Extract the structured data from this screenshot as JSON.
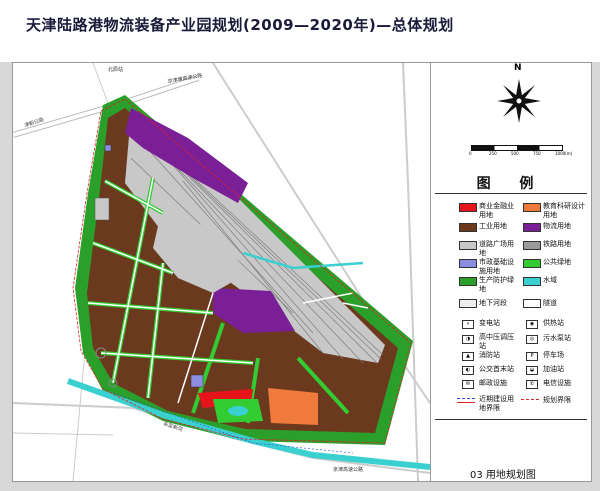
{
  "title": "天津陆路港物流装备产业园规划(2009—2020年)—总体规划",
  "footer": "03 用地规划图",
  "north_label": "N",
  "scale_ticks": [
    "0",
    "250",
    "500",
    "750",
    "1000(m)"
  ],
  "map_labels": {
    "road_top": "京津塘高速公路",
    "road_left": "津蓟公路",
    "road_bottom": "京津高速公路",
    "river": "永定新河",
    "station_top": "北辰站"
  },
  "legend": {
    "heading": "图 例",
    "items": [
      {
        "label": "商业金融业用地",
        "color": "#e8141c"
      },
      {
        "label": "教育科研设计用地",
        "color": "#f07a3c"
      },
      {
        "label": "工业用地",
        "color": "#6b3a1e"
      },
      {
        "label": "物流用地",
        "color": "#7a1f96"
      },
      {
        "label": "道路广场用地",
        "color": "#c8c8c8"
      },
      {
        "label": "铁路用地",
        "color": "#9a9a9a"
      },
      {
        "label": "市政基础设施用地",
        "color": "#8c8ce0"
      },
      {
        "label": "公共绿地",
        "color": "#33cc33"
      },
      {
        "label": "生产防护绿地",
        "color": "#2aa02a"
      },
      {
        "label": "水域",
        "color": "#3ad0d0"
      },
      {
        "label": "地下河段",
        "color": "#eeeeee"
      },
      {
        "label": "隧道",
        "color": "#ffffff"
      }
    ],
    "symbols": [
      {
        "label": "变电站",
        "glyph": "⚡"
      },
      {
        "label": "供热站",
        "glyph": "◉"
      },
      {
        "label": "高中压调压站",
        "glyph": "◑"
      },
      {
        "label": "污水泵站",
        "glyph": "◎"
      },
      {
        "label": "消防站",
        "glyph": "▲"
      },
      {
        "label": "停车场",
        "glyph": "P"
      },
      {
        "label": "公交首末站",
        "glyph": "◐"
      },
      {
        "label": "加油站",
        "glyph": "◒"
      },
      {
        "label": "邮政设施",
        "glyph": "✉"
      },
      {
        "label": "电信设施",
        "glyph": "✆"
      },
      {
        "label": "近期建设用地界限",
        "line": "#2a4bd8"
      },
      {
        "label": "规划界限",
        "line": "#e0202a"
      }
    ]
  }
}
